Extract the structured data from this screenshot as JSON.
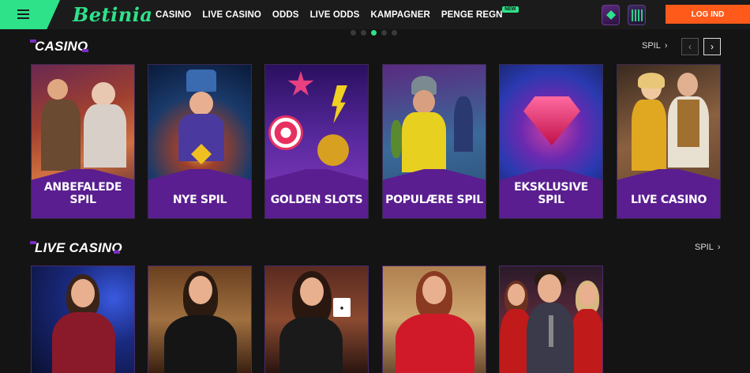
{
  "header": {
    "logo": "Betinia",
    "nav": [
      "CASINO",
      "LIVE CASINO",
      "ODDS",
      "LIVE ODDS",
      "KAMPAGNER",
      "PENGE REGN"
    ],
    "new_badge": "NEW",
    "login": "LOG IND",
    "icons": [
      "menu-icon",
      "vip-badge-icon",
      "tournament-badge-icon"
    ]
  },
  "carousel": {
    "dots": 5,
    "active_index": 2
  },
  "casino": {
    "title": "CASINO",
    "spil_link": "SPIL",
    "prev": "‹",
    "next": "›",
    "cards": [
      {
        "label": "ANBEFALEDE SPIL",
        "accent": "#b4503a"
      },
      {
        "label": "NYE SPIL",
        "accent": "#2a7ab0"
      },
      {
        "label": "GOLDEN SLOTS",
        "accent": "#8a30c0"
      },
      {
        "label": "POPULÆRE SPIL",
        "accent": "#2a8ab0"
      },
      {
        "label": "EKSKLUSIVE SPIL",
        "accent": "#3a2a90"
      },
      {
        "label": "LIVE CASINO",
        "accent": "#a06030"
      }
    ]
  },
  "live_casino": {
    "title": "LIVE CASINO",
    "spil_link": "SPIL"
  },
  "colors": {
    "brand_green": "#2ee28a",
    "login_orange": "#ff5a1a",
    "card_purple": "#5a1e90"
  }
}
